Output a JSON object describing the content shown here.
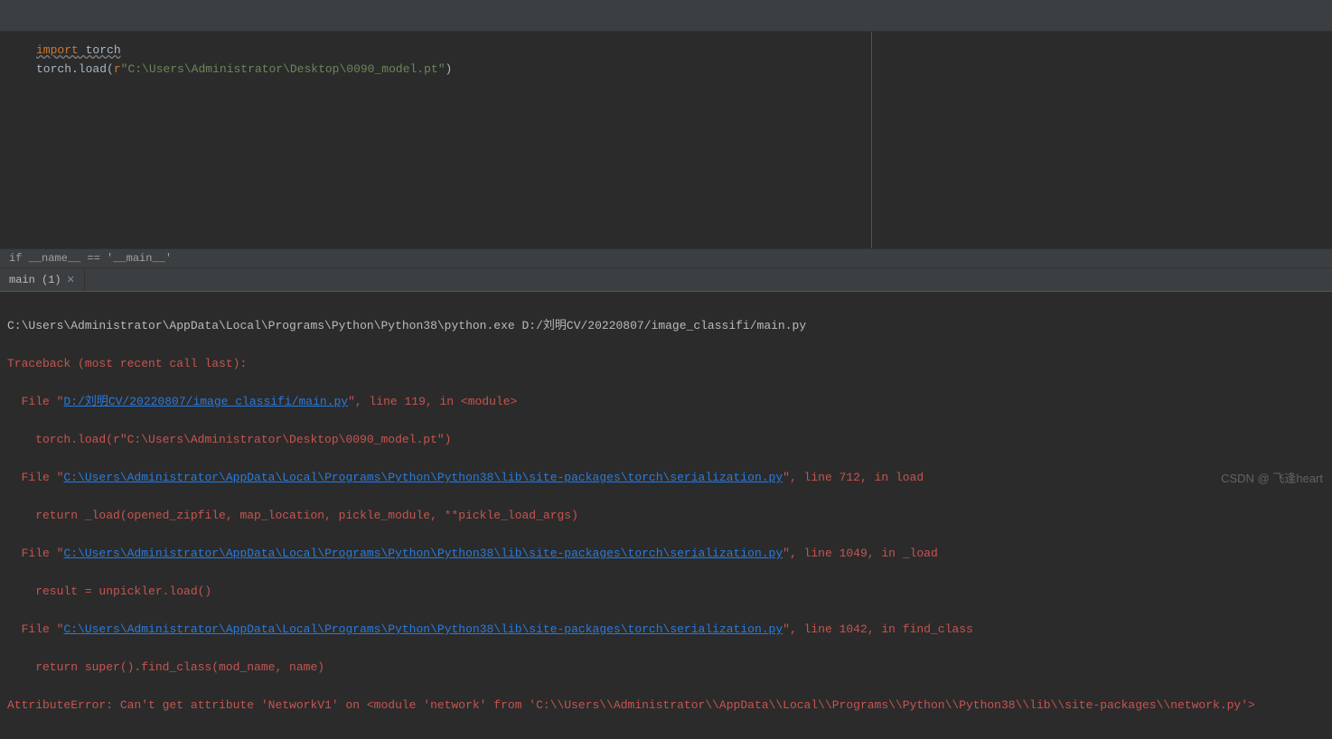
{
  "editor": {
    "line1_import": "import",
    "line1_torch": " torch",
    "line2_pre": "torch.load(",
    "line2_prefix": "r",
    "line2_str": "\"C:\\Users\\Administrator\\Desktop\\0090_model.pt\"",
    "line2_post": ")"
  },
  "breadcrumb": "if __name__ == '__main__'",
  "tab": {
    "label": "main (1)"
  },
  "console": {
    "cmd": "C:\\Users\\Administrator\\AppData\\Local\\Programs\\Python\\Python38\\python.exe D:/刘明CV/20220807/image_classifi/main.py",
    "traceback": "Traceback (most recent call last):",
    "f1_pre": "  File \"",
    "f1_link": "D:/刘明CV/20220807/image_classifi/main.py",
    "f1_post": "\", line 119, in <module>",
    "f1_src": "    torch.load(r\"C:\\Users\\Administrator\\Desktop\\0090_model.pt\")",
    "f2_pre": "  File \"",
    "f2_link": "C:\\Users\\Administrator\\AppData\\Local\\Programs\\Python\\Python38\\lib\\site-packages\\torch\\serialization.py",
    "f2_post": "\", line 712, in load",
    "f2_src": "    return _load(opened_zipfile, map_location, pickle_module, **pickle_load_args)",
    "f3_pre": "  File \"",
    "f3_link": "C:\\Users\\Administrator\\AppData\\Local\\Programs\\Python\\Python38\\lib\\site-packages\\torch\\serialization.py",
    "f3_post": "\", line 1049, in _load",
    "f3_src": "    result = unpickler.load()",
    "f4_pre": "  File \"",
    "f4_link": "C:\\Users\\Administrator\\AppData\\Local\\Programs\\Python\\Python38\\lib\\site-packages\\torch\\serialization.py",
    "f4_post": "\", line 1042, in find_class",
    "f4_src": "    return super().find_class(mod_name, name)",
    "error": "AttributeError: Can't get attribute 'NetworkV1' on <module 'network' from 'C:\\\\Users\\\\Administrator\\\\AppData\\\\Local\\\\Programs\\\\Python\\\\Python38\\\\lib\\\\site-packages\\\\network.py'>"
  },
  "watermark": "CSDN @ 飞逢heart"
}
